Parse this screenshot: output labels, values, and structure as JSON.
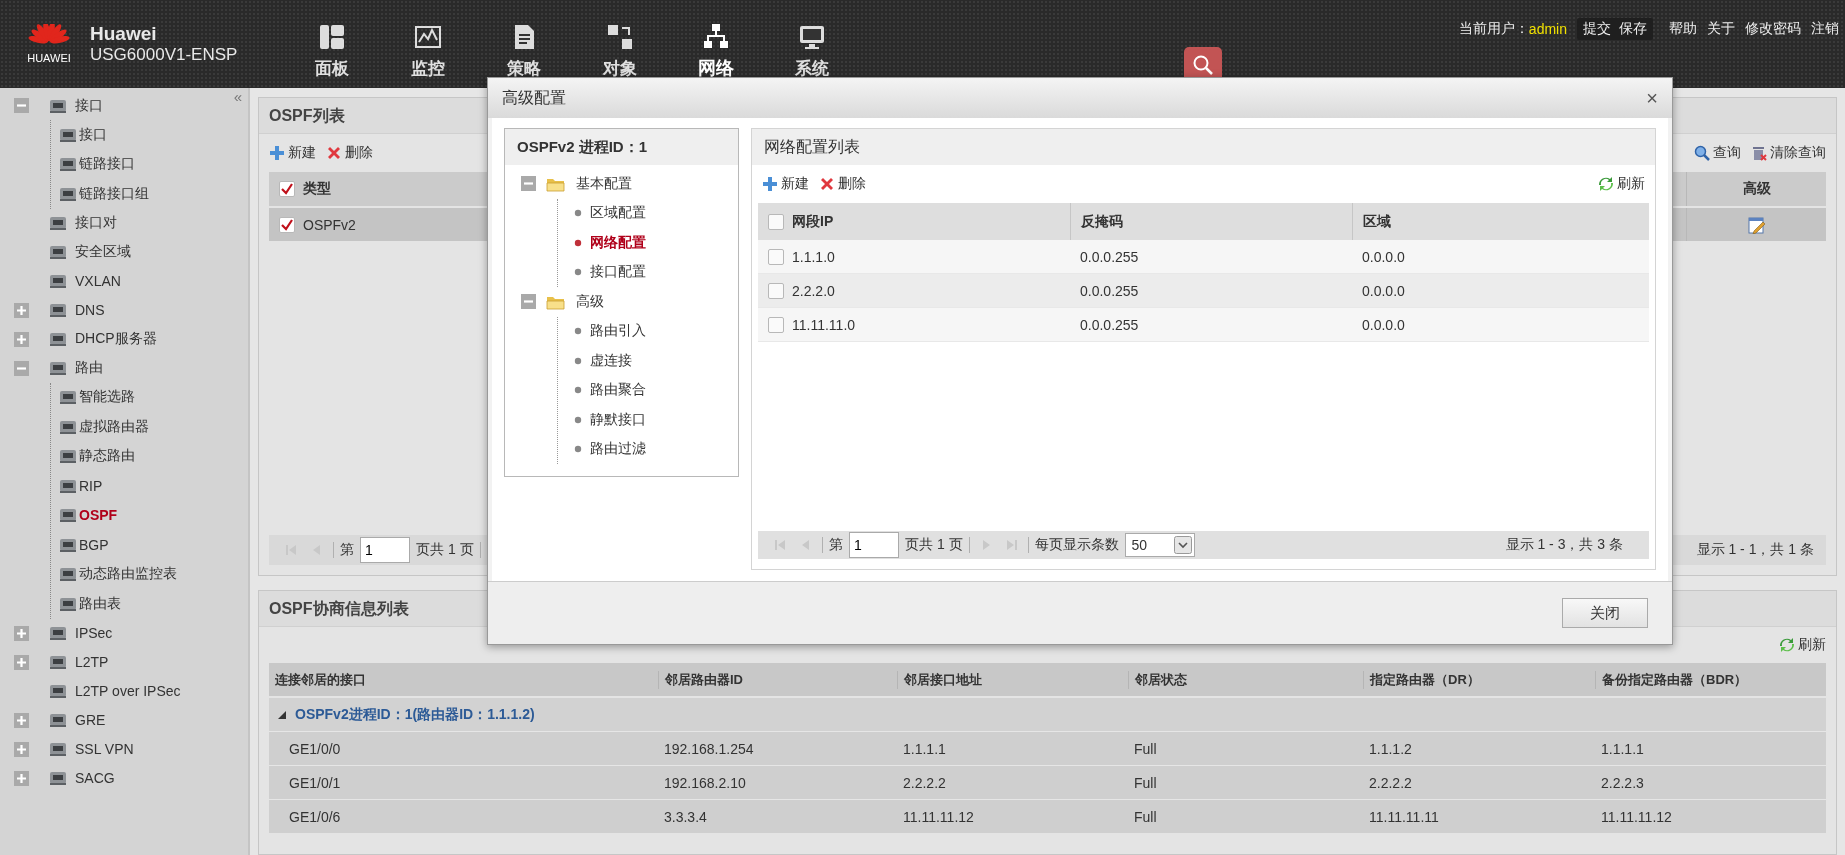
{
  "header": {
    "logo_text": "HUAWEI",
    "brand": "Huawei",
    "model": "USG6000V1-ENSP",
    "nav": [
      {
        "label": "面板",
        "selected": false
      },
      {
        "label": "监控",
        "selected": false
      },
      {
        "label": "策略",
        "selected": false
      },
      {
        "label": "对象",
        "selected": false
      },
      {
        "label": "网络",
        "selected": true
      },
      {
        "label": "系统",
        "selected": false
      }
    ],
    "user_label": "当前用户：",
    "user": "admin",
    "actions": [
      "提交",
      "保存"
    ],
    "links": [
      "帮助",
      "关于",
      "修改密码",
      "注销"
    ]
  },
  "sidebar": {
    "collapse": "«",
    "items": [
      {
        "label": "接口",
        "expanded": true,
        "selected": false,
        "children": [
          {
            "label": "接口",
            "selected": false
          },
          {
            "label": "链路接口",
            "selected": false
          },
          {
            "label": "链路接口组",
            "selected": false
          }
        ]
      },
      {
        "label": "接口对",
        "selected": false
      },
      {
        "label": "安全区域",
        "selected": false
      },
      {
        "label": "VXLAN",
        "selected": false
      },
      {
        "label": "DNS",
        "expanded": false,
        "selected": false
      },
      {
        "label": "DHCP服务器",
        "expanded": false,
        "selected": false
      },
      {
        "label": "路由",
        "expanded": true,
        "selected": false,
        "children": [
          {
            "label": "智能选路",
            "selected": false
          },
          {
            "label": "虚拟路由器",
            "selected": false
          },
          {
            "label": "静态路由",
            "selected": false
          },
          {
            "label": "RIP",
            "selected": false
          },
          {
            "label": "OSPF",
            "selected": true
          },
          {
            "label": "BGP",
            "selected": false
          },
          {
            "label": "动态路由监控表",
            "selected": false
          },
          {
            "label": "路由表",
            "selected": false
          }
        ]
      },
      {
        "label": "IPSec",
        "expanded": false,
        "selected": false
      },
      {
        "label": "L2TP",
        "expanded": false,
        "selected": false
      },
      {
        "label": "L2TP over IPSec",
        "selected": false
      },
      {
        "label": "GRE",
        "expanded": false,
        "selected": false
      },
      {
        "label": "SSL VPN",
        "expanded": false,
        "selected": false
      },
      {
        "label": "SACG",
        "expanded": false,
        "selected": false
      }
    ]
  },
  "ospf_list": {
    "title": "OSPF列表",
    "toolbar": [
      {
        "kind": "add",
        "label": "新建"
      },
      {
        "kind": "delete",
        "label": "删除"
      }
    ],
    "search_tools": [
      {
        "kind": "search",
        "label": "查询"
      },
      {
        "kind": "clear",
        "label": "清除查询"
      }
    ],
    "columns": [
      "类型",
      "高级"
    ],
    "header_checked": true,
    "rows": [
      {
        "type": "OSPFv2",
        "checked": true,
        "selected": true
      }
    ],
    "pager": {
      "page_prefix": "第",
      "page": "1",
      "page_suffix": "页共 1 页",
      "summary": "显示 1 - 1，共 1 条"
    }
  },
  "negotiation": {
    "title": "OSPF协商信息列表",
    "refresh": "刷新",
    "columns": [
      "连接邻居的接口",
      "邻居路由器ID",
      "邻居接口地址",
      "邻居状态",
      "指定路由器（DR）",
      "备份指定路由器（BDR）"
    ],
    "groups": [
      {
        "label": "OSPFv2进程ID：1(路由器ID：1.1.1.2)",
        "expanded": true,
        "rows": [
          [
            "GE1/0/0",
            "192.168.1.254",
            "1.1.1.1",
            "Full",
            "1.1.1.2",
            "1.1.1.1"
          ],
          [
            "GE1/0/1",
            "192.168.2.10",
            "2.2.2.2",
            "Full",
            "2.2.2.2",
            "2.2.2.3"
          ],
          [
            "GE1/0/6",
            "3.3.3.4",
            "11.11.11.12",
            "Full",
            "11.11.11.11",
            "11.11.11.12"
          ]
        ]
      }
    ]
  },
  "dialog": {
    "title": "高级配置",
    "close": "×",
    "tree_title": "OSPFv2 进程ID：1",
    "tree": [
      {
        "label": "基本配置",
        "expanded": true,
        "selected": false,
        "children": [
          {
            "label": "区域配置",
            "selected": false
          },
          {
            "label": "网络配置",
            "selected": true
          },
          {
            "label": "接口配置",
            "selected": false
          }
        ]
      },
      {
        "label": "高级",
        "expanded": true,
        "selected": false,
        "children": [
          {
            "label": "路由引入",
            "selected": false
          },
          {
            "label": "虚连接",
            "selected": false
          },
          {
            "label": "路由聚合",
            "selected": false
          },
          {
            "label": "静默接口",
            "selected": false
          },
          {
            "label": "路由过滤",
            "selected": false
          }
        ]
      }
    ],
    "list": {
      "title": "网络配置列表",
      "toolbar": [
        {
          "kind": "add",
          "label": "新建"
        },
        {
          "kind": "delete",
          "label": "删除"
        }
      ],
      "refresh": "刷新",
      "columns": [
        "网段IP",
        "反掩码",
        "区域"
      ],
      "header_checked": false,
      "rows": [
        {
          "cells": [
            "1.1.1.0",
            "0.0.0.255",
            "0.0.0.0"
          ],
          "checked": false
        },
        {
          "cells": [
            "2.2.2.0",
            "0.0.0.255",
            "0.0.0.0"
          ],
          "checked": false
        },
        {
          "cells": [
            "11.11.11.0",
            "0.0.0.255",
            "0.0.0.0"
          ],
          "checked": false
        }
      ],
      "pager": {
        "page_prefix": "第",
        "page": "1",
        "page_suffix": "页共 1 页",
        "per_page_label": "每页显示条数",
        "per_page": "50",
        "summary": "显示 1 - 3，共 3 条"
      }
    },
    "buttons": [
      "关闭"
    ]
  }
}
